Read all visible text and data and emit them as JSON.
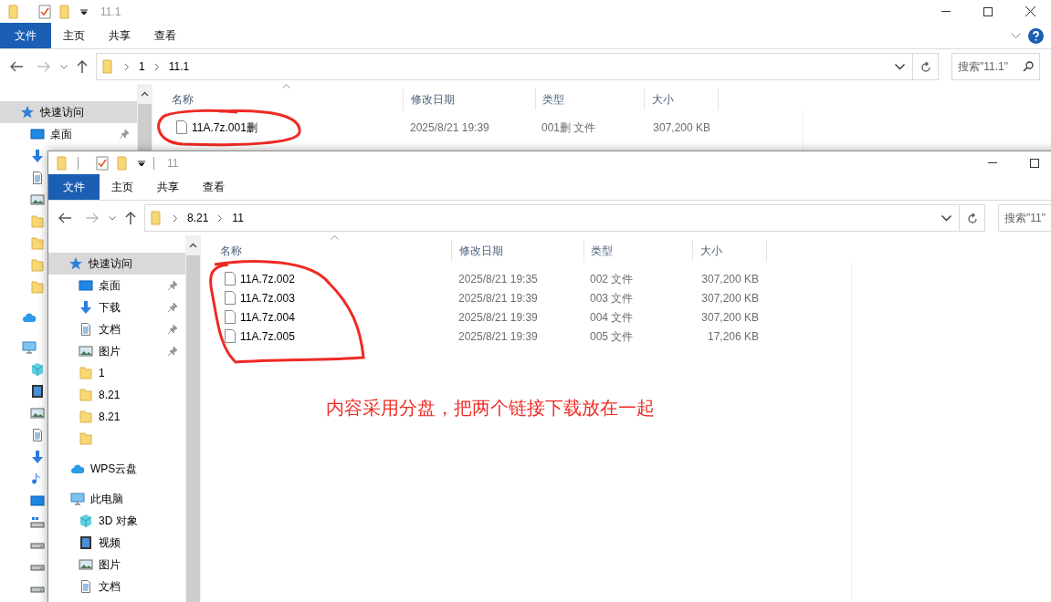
{
  "back_window": {
    "title": "11.1",
    "tabs": [
      {
        "label": "文件",
        "kind": "file"
      },
      {
        "label": "主页",
        "kind": "tab"
      },
      {
        "label": "共享",
        "kind": "tab"
      },
      {
        "label": "查看",
        "kind": "tab"
      }
    ],
    "breadcrumb": [
      "1",
      "11.1"
    ],
    "search": {
      "placeholder": "搜索\"11.1\""
    },
    "sidebar": [
      {
        "kind": "star",
        "label": "快速访问",
        "selected": true,
        "children": [
          {
            "kind": "desktop",
            "label": "桌面",
            "selected": false,
            "pinned": true
          },
          {
            "kind": "download",
            "selected": false
          },
          {
            "kind": "doc",
            "selected": false
          },
          {
            "kind": "picture",
            "selected": false
          },
          {
            "kind": "folder",
            "selected": false
          },
          {
            "kind": "folder",
            "selected": false
          },
          {
            "kind": "folder",
            "selected": false
          },
          {
            "kind": "folder",
            "selected": false
          }
        ]
      },
      {
        "kind": "cloud",
        "selected": false
      },
      {
        "kind": "pc",
        "selected": false,
        "children": [
          {
            "kind": "cube",
            "selected": false
          },
          {
            "kind": "video",
            "selected": false
          },
          {
            "kind": "picture",
            "selected": false
          },
          {
            "kind": "doc",
            "selected": false
          },
          {
            "kind": "download",
            "selected": false
          },
          {
            "kind": "music",
            "selected": false
          },
          {
            "kind": "desktop",
            "selected": false
          },
          {
            "kind": "system-drive",
            "selected": false
          },
          {
            "kind": "drive",
            "selected": false
          },
          {
            "kind": "drive",
            "selected": false
          },
          {
            "kind": "drive",
            "selected": false
          }
        ]
      }
    ],
    "columns": [
      "名称",
      "修改日期",
      "类型",
      "大小"
    ],
    "files": [
      {
        "name": "11A.7z.001删",
        "modified": "2025/8/21 19:39",
        "type": "001删 文件",
        "size": "307,200 KB"
      }
    ]
  },
  "front_window": {
    "title": "11",
    "tabs": [
      {
        "label": "文件",
        "kind": "file"
      },
      {
        "label": "主页",
        "kind": "tab"
      },
      {
        "label": "共享",
        "kind": "tab"
      },
      {
        "label": "查看",
        "kind": "tab"
      }
    ],
    "breadcrumb": [
      "8.21",
      "11"
    ],
    "search": {
      "placeholder": "搜索\"11\""
    },
    "sidebar": [
      {
        "kind": "star",
        "label": "快速访问",
        "selected": true,
        "children": [
          {
            "kind": "desktop",
            "label": "桌面",
            "selected": false,
            "pinned": true
          },
          {
            "kind": "download",
            "label": "下载",
            "selected": false,
            "pinned": true
          },
          {
            "kind": "doc",
            "label": "文档",
            "selected": false,
            "pinned": true
          },
          {
            "kind": "picture",
            "label": "图片",
            "selected": false,
            "pinned": true
          },
          {
            "kind": "folder",
            "label": "1",
            "selected": false,
            "pinned": false
          },
          {
            "kind": "folder",
            "label": "8.21",
            "selected": false,
            "pinned": false
          },
          {
            "kind": "folder",
            "label": "8.21",
            "selected": false,
            "pinned": false
          },
          {
            "kind": "folder",
            "selected": false
          }
        ]
      },
      {
        "kind": "cloud",
        "label": "WPS云盘",
        "selected": false
      },
      {
        "kind": "pc",
        "label": "此电脑",
        "selected": false,
        "children": [
          {
            "kind": "cube",
            "label": "3D 对象",
            "selected": false
          },
          {
            "kind": "video",
            "label": "视频",
            "selected": false
          },
          {
            "kind": "picture",
            "label": "图片",
            "selected": false
          },
          {
            "kind": "doc",
            "label": "文档",
            "selected": false
          }
        ]
      }
    ],
    "columns": [
      "名称",
      "修改日期",
      "类型",
      "大小"
    ],
    "files": [
      {
        "name": "11A.7z.002",
        "modified": "2025/8/21 19:35",
        "type": "002 文件",
        "size": "307,200 KB"
      },
      {
        "name": "11A.7z.003",
        "modified": "2025/8/21 19:39",
        "type": "003 文件",
        "size": "307,200 KB"
      },
      {
        "name": "11A.7z.004",
        "modified": "2025/8/21 19:39",
        "type": "004 文件",
        "size": "307,200 KB"
      },
      {
        "name": "11A.7z.005",
        "modified": "2025/8/21 19:39",
        "type": "005 文件",
        "size": "17,206 KB"
      }
    ]
  },
  "annotation": {
    "text": "内容采用分盘，把两个链接下载放在一起"
  }
}
